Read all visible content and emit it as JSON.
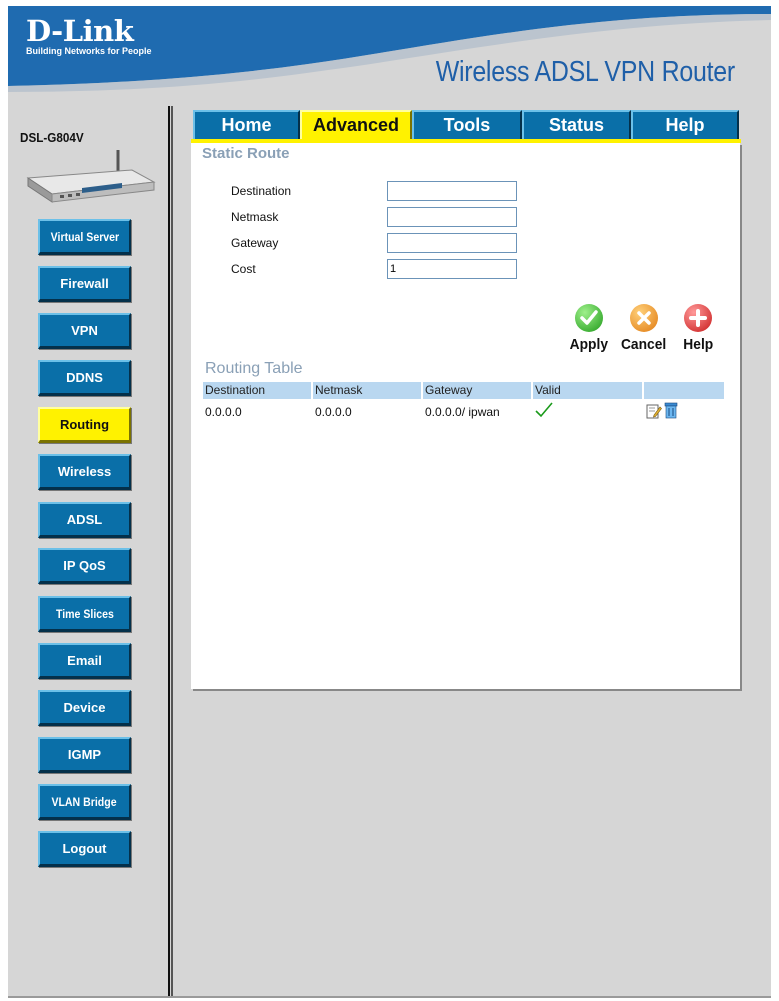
{
  "brand": {
    "logo": "D-Link",
    "tagline": "Building Networks for People",
    "product_title": "Wireless ADSL VPN Router",
    "model": "DSL-G804V"
  },
  "colors": {
    "nav_blue": "#0a6fa8",
    "active_yellow": "#fff200",
    "title_blue": "#1f5fa8",
    "section_gray": "#8aa0b6",
    "table_header": "#b9d7f0"
  },
  "tabs": [
    {
      "label": "Home",
      "active": false
    },
    {
      "label": "Advanced",
      "active": true
    },
    {
      "label": "Tools",
      "active": false
    },
    {
      "label": "Status",
      "active": false
    },
    {
      "label": "Help",
      "active": false
    }
  ],
  "sidebar": {
    "items": [
      {
        "label": "Virtual Server",
        "active": false
      },
      {
        "label": "Firewall",
        "active": false
      },
      {
        "label": "VPN",
        "active": false
      },
      {
        "label": "DDNS",
        "active": false
      },
      {
        "label": "Routing",
        "active": true
      },
      {
        "label": "Wireless",
        "active": false
      },
      {
        "label": "ADSL",
        "active": false
      },
      {
        "label": "IP QoS",
        "active": false
      },
      {
        "label": "Time Slices",
        "active": false
      },
      {
        "label": "Email",
        "active": false
      },
      {
        "label": "Device",
        "active": false
      },
      {
        "label": "IGMP",
        "active": false
      },
      {
        "label": "VLAN Bridge",
        "active": false
      },
      {
        "label": "Logout",
        "active": false
      }
    ]
  },
  "static_route": {
    "title": "Static Route",
    "fields": {
      "destination": {
        "label": "Destination",
        "value": ""
      },
      "netmask": {
        "label": "Netmask",
        "value": ""
      },
      "gateway": {
        "label": "Gateway",
        "value": ""
      },
      "cost": {
        "label": "Cost",
        "value": "1"
      }
    }
  },
  "actions": {
    "apply": {
      "label": "Apply",
      "icon": "check-icon"
    },
    "cancel": {
      "label": "Cancel",
      "icon": "x-icon"
    },
    "help": {
      "label": "Help",
      "icon": "plus-icon"
    }
  },
  "routing_table": {
    "title": "Routing Table",
    "columns": [
      "Destination",
      "Netmask",
      "Gateway",
      "Valid",
      ""
    ],
    "rows": [
      {
        "destination": "0.0.0.0",
        "netmask": "0.0.0.0",
        "gateway": "0.0.0.0/ ipwan",
        "valid": true
      }
    ]
  }
}
